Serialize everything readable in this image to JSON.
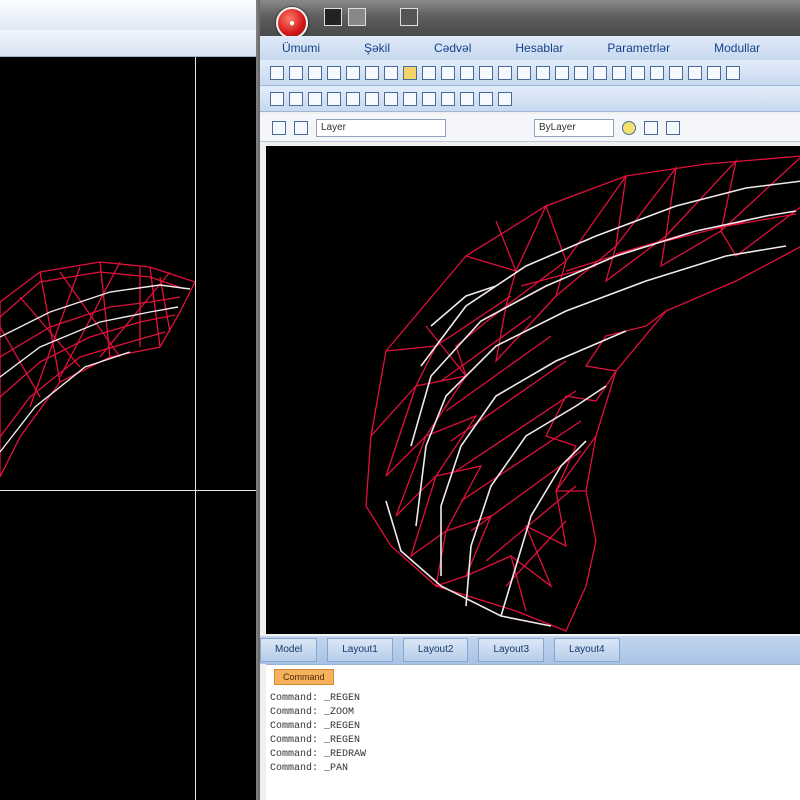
{
  "ribbon": {
    "tabs": [
      "Ümumi",
      "Şəkil",
      "Cədvəl",
      "Hesablar",
      "Parametrlər",
      "Modullar"
    ]
  },
  "properties_bar": {
    "layer_combo": "Layer",
    "linetype_combo": "ByLayer"
  },
  "layout_tabs": [
    "Model",
    "Layout1",
    "Layout2",
    "Layout3",
    "Layout4"
  ],
  "command_window": {
    "header": "Command",
    "lines": [
      "Command: _REGEN",
      "Command: _ZOOM",
      "Command: _REGEN",
      "Command: _REGEN",
      "Command: _REDRAW",
      "Command: _PAN"
    ]
  },
  "app_button_icon": "application-button-icon",
  "colors": {
    "mesh_red": "#e0103a",
    "contour_white": "#f2e8ea",
    "viewport_bg": "#000000"
  }
}
